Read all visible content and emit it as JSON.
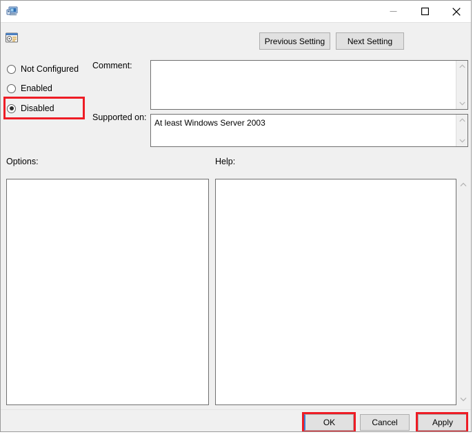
{
  "window": {
    "title": "",
    "titlebar_icon": "computer-policy-icon",
    "controls": {
      "minimize": "—",
      "maximize": "□",
      "close": "✕"
    }
  },
  "toolbar": {
    "setting_icon": "policy-setting-icon",
    "previous_setting_label": "Previous Setting",
    "next_setting_label": "Next Setting"
  },
  "state_options": {
    "items": [
      {
        "label": "Not Configured",
        "selected": false
      },
      {
        "label": "Enabled",
        "selected": false
      },
      {
        "label": "Disabled",
        "selected": true
      }
    ],
    "selected_value": "Disabled"
  },
  "fields": {
    "comment_label": "Comment:",
    "comment_value": "",
    "supported_on_label": "Supported on:",
    "supported_on_value": "At least Windows Server 2003"
  },
  "panes": {
    "options_label": "Options:",
    "options_content": "",
    "help_label": "Help:",
    "help_content": ""
  },
  "scrollbar": {
    "up_arrow": "∧",
    "down_arrow": "∨"
  },
  "footer": {
    "ok_label": "OK",
    "cancel_label": "Cancel",
    "apply_label": "Apply"
  },
  "annotations": {
    "highlight_color": "#ee1c25",
    "highlighted": [
      "Disabled",
      "OK",
      "Apply"
    ]
  }
}
